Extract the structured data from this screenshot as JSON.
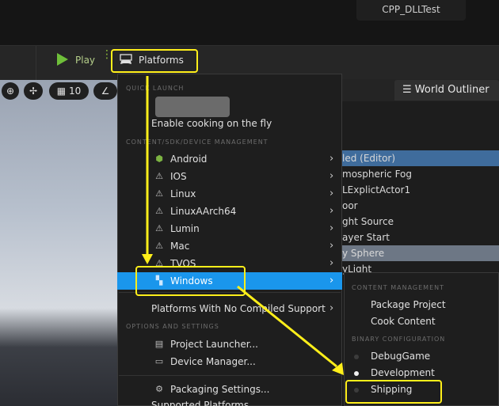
{
  "window": {
    "project_name": "CPP_DLLTest"
  },
  "toolbar": {
    "play_label": "Play",
    "platforms_label": "Platforms"
  },
  "viewport": {
    "grid_value": "10"
  },
  "outliner": {
    "tab_label": "World Outliner",
    "rows": [
      "led (Editor)",
      "mospheric Fog",
      "LExplictActor1",
      "oor",
      "ght Source",
      "ayer Start",
      "y Sphere",
      "yLight"
    ]
  },
  "menu": {
    "quick_launch_header": "QUICK LAUNCH",
    "cook_label": "Enable cooking on the fly",
    "sdk_header": "CONTENT/SDK/DEVICE MANAGEMENT",
    "platforms": [
      {
        "label": "Android",
        "icon": "android-icon"
      },
      {
        "label": "IOS",
        "icon": "warning-icon"
      },
      {
        "label": "Linux",
        "icon": "warning-icon"
      },
      {
        "label": "LinuxAArch64",
        "icon": "warning-icon"
      },
      {
        "label": "Lumin",
        "icon": "warning-icon"
      },
      {
        "label": "Mac",
        "icon": "warning-icon"
      },
      {
        "label": "TVOS",
        "icon": "warning-icon"
      }
    ],
    "windows_label": "Windows",
    "no_compiled_label": "Platforms With No Compiled Support",
    "options_header": "OPTIONS AND SETTINGS",
    "project_launcher": "Project Launcher...",
    "device_manager": "Device Manager...",
    "packaging_settings": "Packaging Settings...",
    "supported_platforms": "Supported Platforms..."
  },
  "submenu": {
    "content_header": "CONTENT MANAGEMENT",
    "package_project": "Package Project",
    "cook_content": "Cook Content",
    "binary_header": "BINARY CONFIGURATION",
    "configs": [
      {
        "label": "DebugGame",
        "selected": false
      },
      {
        "label": "Development",
        "selected": true
      },
      {
        "label": "Shipping",
        "selected": false
      }
    ]
  },
  "colors": {
    "highlight": "#1a96ec",
    "annotation": "#ffef1a"
  }
}
